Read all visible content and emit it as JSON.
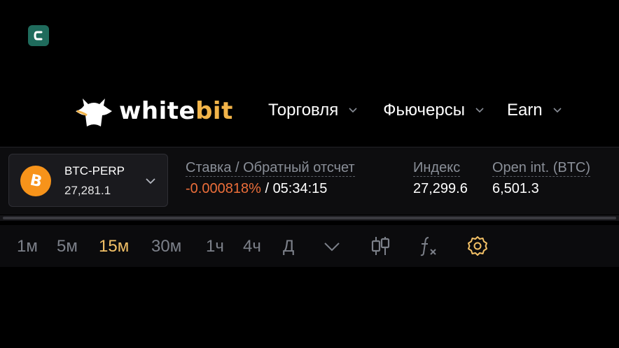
{
  "header": {
    "logo_text_white": "white",
    "logo_text_bit": "bit",
    "nav": [
      {
        "label": "Торговля"
      },
      {
        "label": "Фьючерсы"
      },
      {
        "label": "Earn"
      }
    ]
  },
  "ticker": {
    "symbol": "BTC-PERP",
    "price": "27,281.1",
    "coin_icon": "bitcoin-icon",
    "coin_glyph": "B",
    "funding": {
      "label": "Ставка / Обратный отсчет",
      "rate": "-0.000818%",
      "separator": "/",
      "countdown": "05:34:15"
    },
    "index": {
      "label": "Индекс",
      "value": "27,299.6"
    },
    "open_interest": {
      "label": "Open int. (BTC)",
      "value": "6,501.3"
    }
  },
  "toolbar": {
    "timeframes": [
      "1м",
      "5м",
      "15м",
      "30м",
      "1ч",
      "4ч",
      "Д"
    ],
    "active_timeframe": "15м",
    "icons": [
      "chevron-down-icon",
      "candles-icon",
      "function-icon",
      "gear-icon"
    ]
  },
  "colors": {
    "accent": "#f2c066",
    "negative": "#ec6e3a",
    "bitcoin": "#f7931a",
    "badge": "#1f6b5c"
  }
}
